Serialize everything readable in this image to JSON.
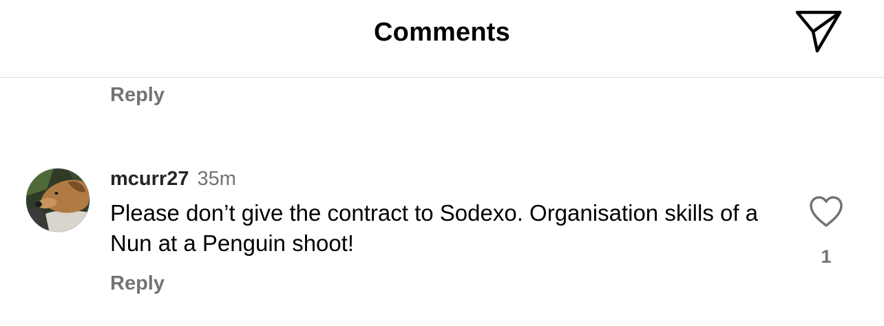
{
  "header": {
    "title": "Comments",
    "share_icon": "paper-plane-icon"
  },
  "previous_comment": {
    "reply_label": "Reply"
  },
  "comment": {
    "username": "mcurr27",
    "timestamp": "35m",
    "text": "Please don’t give the contract to Sodexo. Organisation skills of a Nun at a Penguin shoot!",
    "reply_label": "Reply",
    "like_icon": "heart-outline-icon",
    "like_count": "1",
    "avatar_icon": "dog-avatar"
  },
  "colors": {
    "secondary_text": "#737373",
    "divider": "#dbdbdb",
    "primary_text": "#000000"
  }
}
